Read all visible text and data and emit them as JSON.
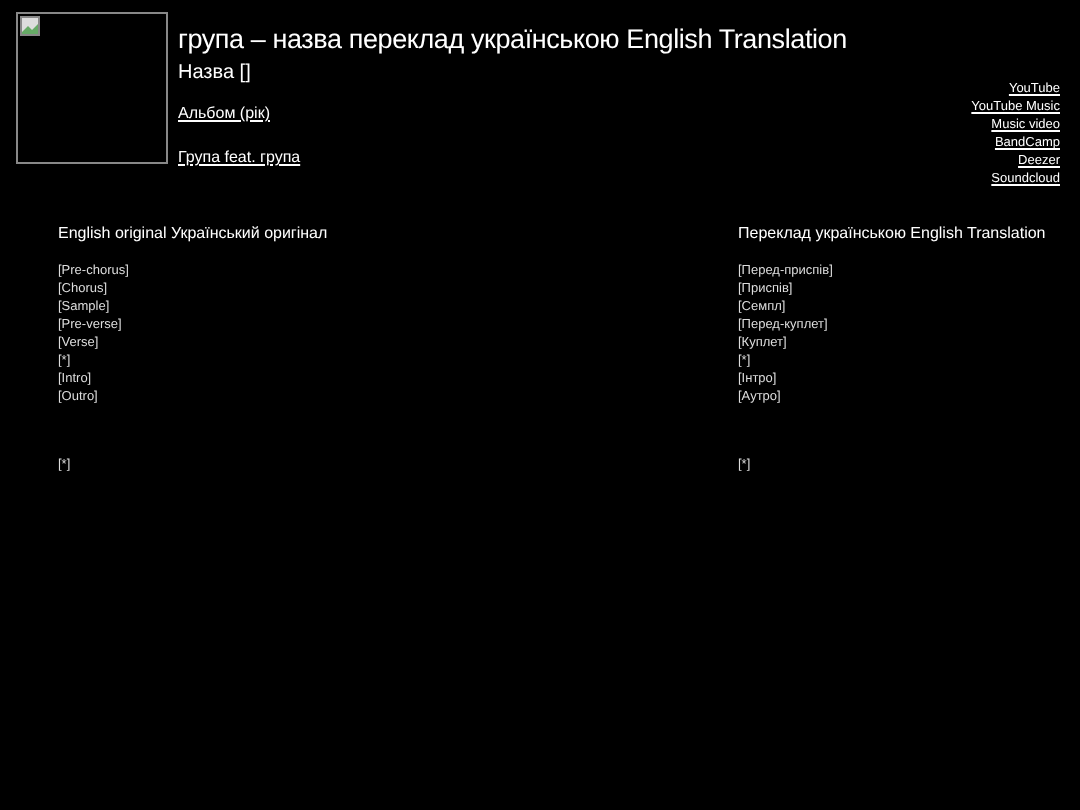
{
  "header": {
    "title": "група – назва переклад українською English Translation",
    "song": "Назва []",
    "album": "Альбом (рік)",
    "artists": "Група feat. група"
  },
  "links": [
    "YouTube",
    "YouTube Music",
    "Music video",
    "BandCamp",
    "Deezer",
    "Soundcloud"
  ],
  "columns": [
    {
      "heading": "English original Український оригінал",
      "lines": [
        "[Pre-chorus]",
        "[Chorus]",
        "[Sample]",
        "[Pre-verse]",
        "[Verse]",
        "[*]",
        "[Intro]",
        "[Outro]"
      ],
      "note": "[*]"
    },
    {
      "heading": "Переклад українською English Translation",
      "lines": [
        "[Перед-приспів]",
        "[Приспів]",
        "[Семпл]",
        "[Перед-куплет]",
        "[Куплет]",
        "[*]",
        "[Інтро]",
        "[Аутро]"
      ],
      "note": "[*]"
    }
  ]
}
